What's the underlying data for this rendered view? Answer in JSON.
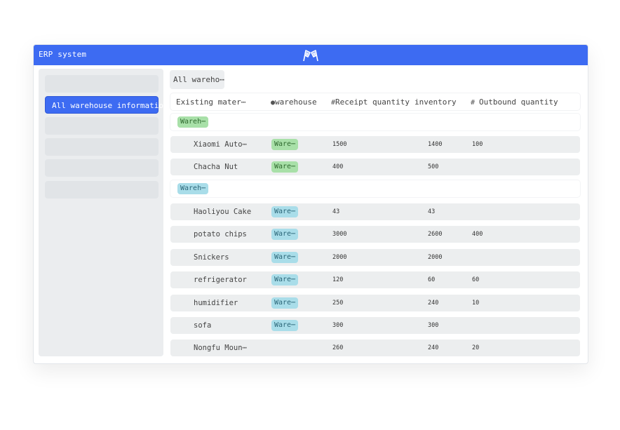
{
  "app": {
    "title": "ERP system",
    "logo_icon": "flags-icon"
  },
  "colors": {
    "accent": "#3d6bf2",
    "tag_green": "#a8e0a8",
    "tag_blue": "#a9dde9"
  },
  "sidebar": {
    "items": [
      {
        "label": ""
      },
      {
        "label": "All warehouse information",
        "active": true
      },
      {
        "label": ""
      },
      {
        "label": ""
      },
      {
        "label": ""
      },
      {
        "label": ""
      }
    ]
  },
  "view": {
    "tab_label": "All wareho⋯"
  },
  "table": {
    "headers": {
      "material": "Existing mater⋯",
      "warehouse": "warehouse",
      "receipt": "Receipt quantity",
      "inventory": "inventory",
      "outbound": "Outbound quantity"
    },
    "groups": [
      {
        "tag": "Wareh⋯",
        "color": "green"
      },
      {
        "tag": "Wareh⋯",
        "color": "blue"
      }
    ],
    "rows": [
      {
        "name": "Xiaomi Auto⋯",
        "warehouse": "Ware⋯",
        "receipt": "1500",
        "inventory": "1400",
        "outbound": "100"
      },
      {
        "name": "Chacha Nut",
        "warehouse": "Ware⋯",
        "receipt": "400",
        "inventory": "500",
        "outbound": ""
      },
      {
        "name": "Haoliyou Cake",
        "warehouse": "Ware⋯",
        "receipt": "43",
        "inventory": "43",
        "outbound": ""
      },
      {
        "name": "potato chips",
        "warehouse": "Ware⋯",
        "receipt": "3000",
        "inventory": "2600",
        "outbound": "400"
      },
      {
        "name": "Snickers",
        "warehouse": "Ware⋯",
        "receipt": "2000",
        "inventory": "2000",
        "outbound": ""
      },
      {
        "name": "refrigerator",
        "warehouse": "Ware⋯",
        "receipt": "120",
        "inventory": "60",
        "outbound": "60"
      },
      {
        "name": "humidifier",
        "warehouse": "Ware⋯",
        "receipt": "250",
        "inventory": "240",
        "outbound": "10"
      },
      {
        "name": "sofa",
        "warehouse": "Ware⋯",
        "receipt": "300",
        "inventory": "300",
        "outbound": ""
      },
      {
        "name": "Nongfu Moun⋯",
        "warehouse": "",
        "receipt": "260",
        "inventory": "240",
        "outbound": "20"
      }
    ]
  }
}
